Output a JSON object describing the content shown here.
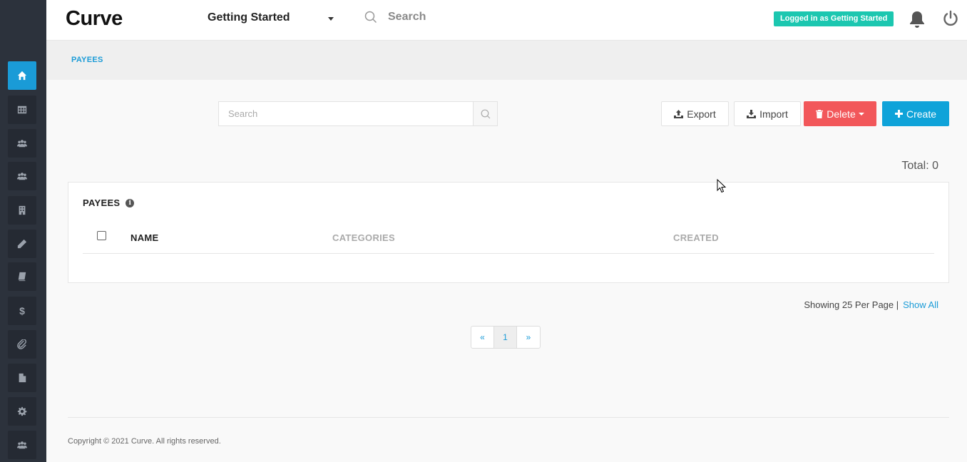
{
  "app": {
    "logo": "Curve"
  },
  "header": {
    "project": "Getting Started",
    "search_placeholder": "Search",
    "login_badge": "Logged in as Getting Started"
  },
  "sidebar": {
    "items": [
      {
        "icon": "home-icon",
        "active": true
      },
      {
        "icon": "table-icon"
      },
      {
        "icon": "users-icon"
      },
      {
        "icon": "group-icon"
      },
      {
        "icon": "building-icon"
      },
      {
        "icon": "pencil-icon"
      },
      {
        "icon": "book-icon"
      },
      {
        "icon": "dollar-icon",
        "glyph": "$"
      },
      {
        "icon": "paperclip-icon"
      },
      {
        "icon": "file-icon"
      },
      {
        "icon": "gear-icon"
      },
      {
        "icon": "team-icon"
      }
    ]
  },
  "breadcrumb": "PAYEES",
  "toolbar": {
    "search_placeholder": "Search",
    "export_label": "Export",
    "import_label": "Import",
    "delete_label": "Delete",
    "create_label": "Create"
  },
  "total": "Total: 0",
  "table": {
    "title": "PAYEES",
    "columns": [
      "NAME",
      "CATEGORIES",
      "CREATED"
    ]
  },
  "pagination": {
    "per_page_text": "Showing 25 Per Page |",
    "show_all": "Show All",
    "prev": "«",
    "current": "1",
    "next": "»"
  },
  "footer": {
    "copyright": "Copyright © 2021 Curve. All rights reserved."
  },
  "colors": {
    "sidebar": "#2c323c",
    "accent": "#1a9bd7",
    "delete": "#f2575a",
    "create": "#0fa3d9",
    "badge": "#1cc7b0"
  }
}
